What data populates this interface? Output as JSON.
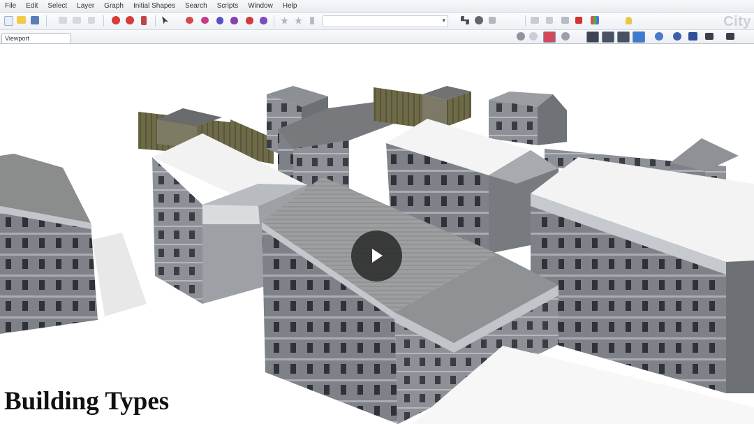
{
  "menu": [
    "File",
    "Edit",
    "Select",
    "Layer",
    "Graph",
    "Initial Shapes",
    "Search",
    "Scripts",
    "Window",
    "Help"
  ],
  "brand": "City",
  "viewport_tab": "Viewport",
  "caption": "Building Types",
  "play_label": "Play video",
  "colors": {
    "roof_white": "#f4f4f4",
    "wall_gray": "#8a8d92",
    "roof_tile": "#9a9c9c",
    "play_bg": "#282828"
  }
}
